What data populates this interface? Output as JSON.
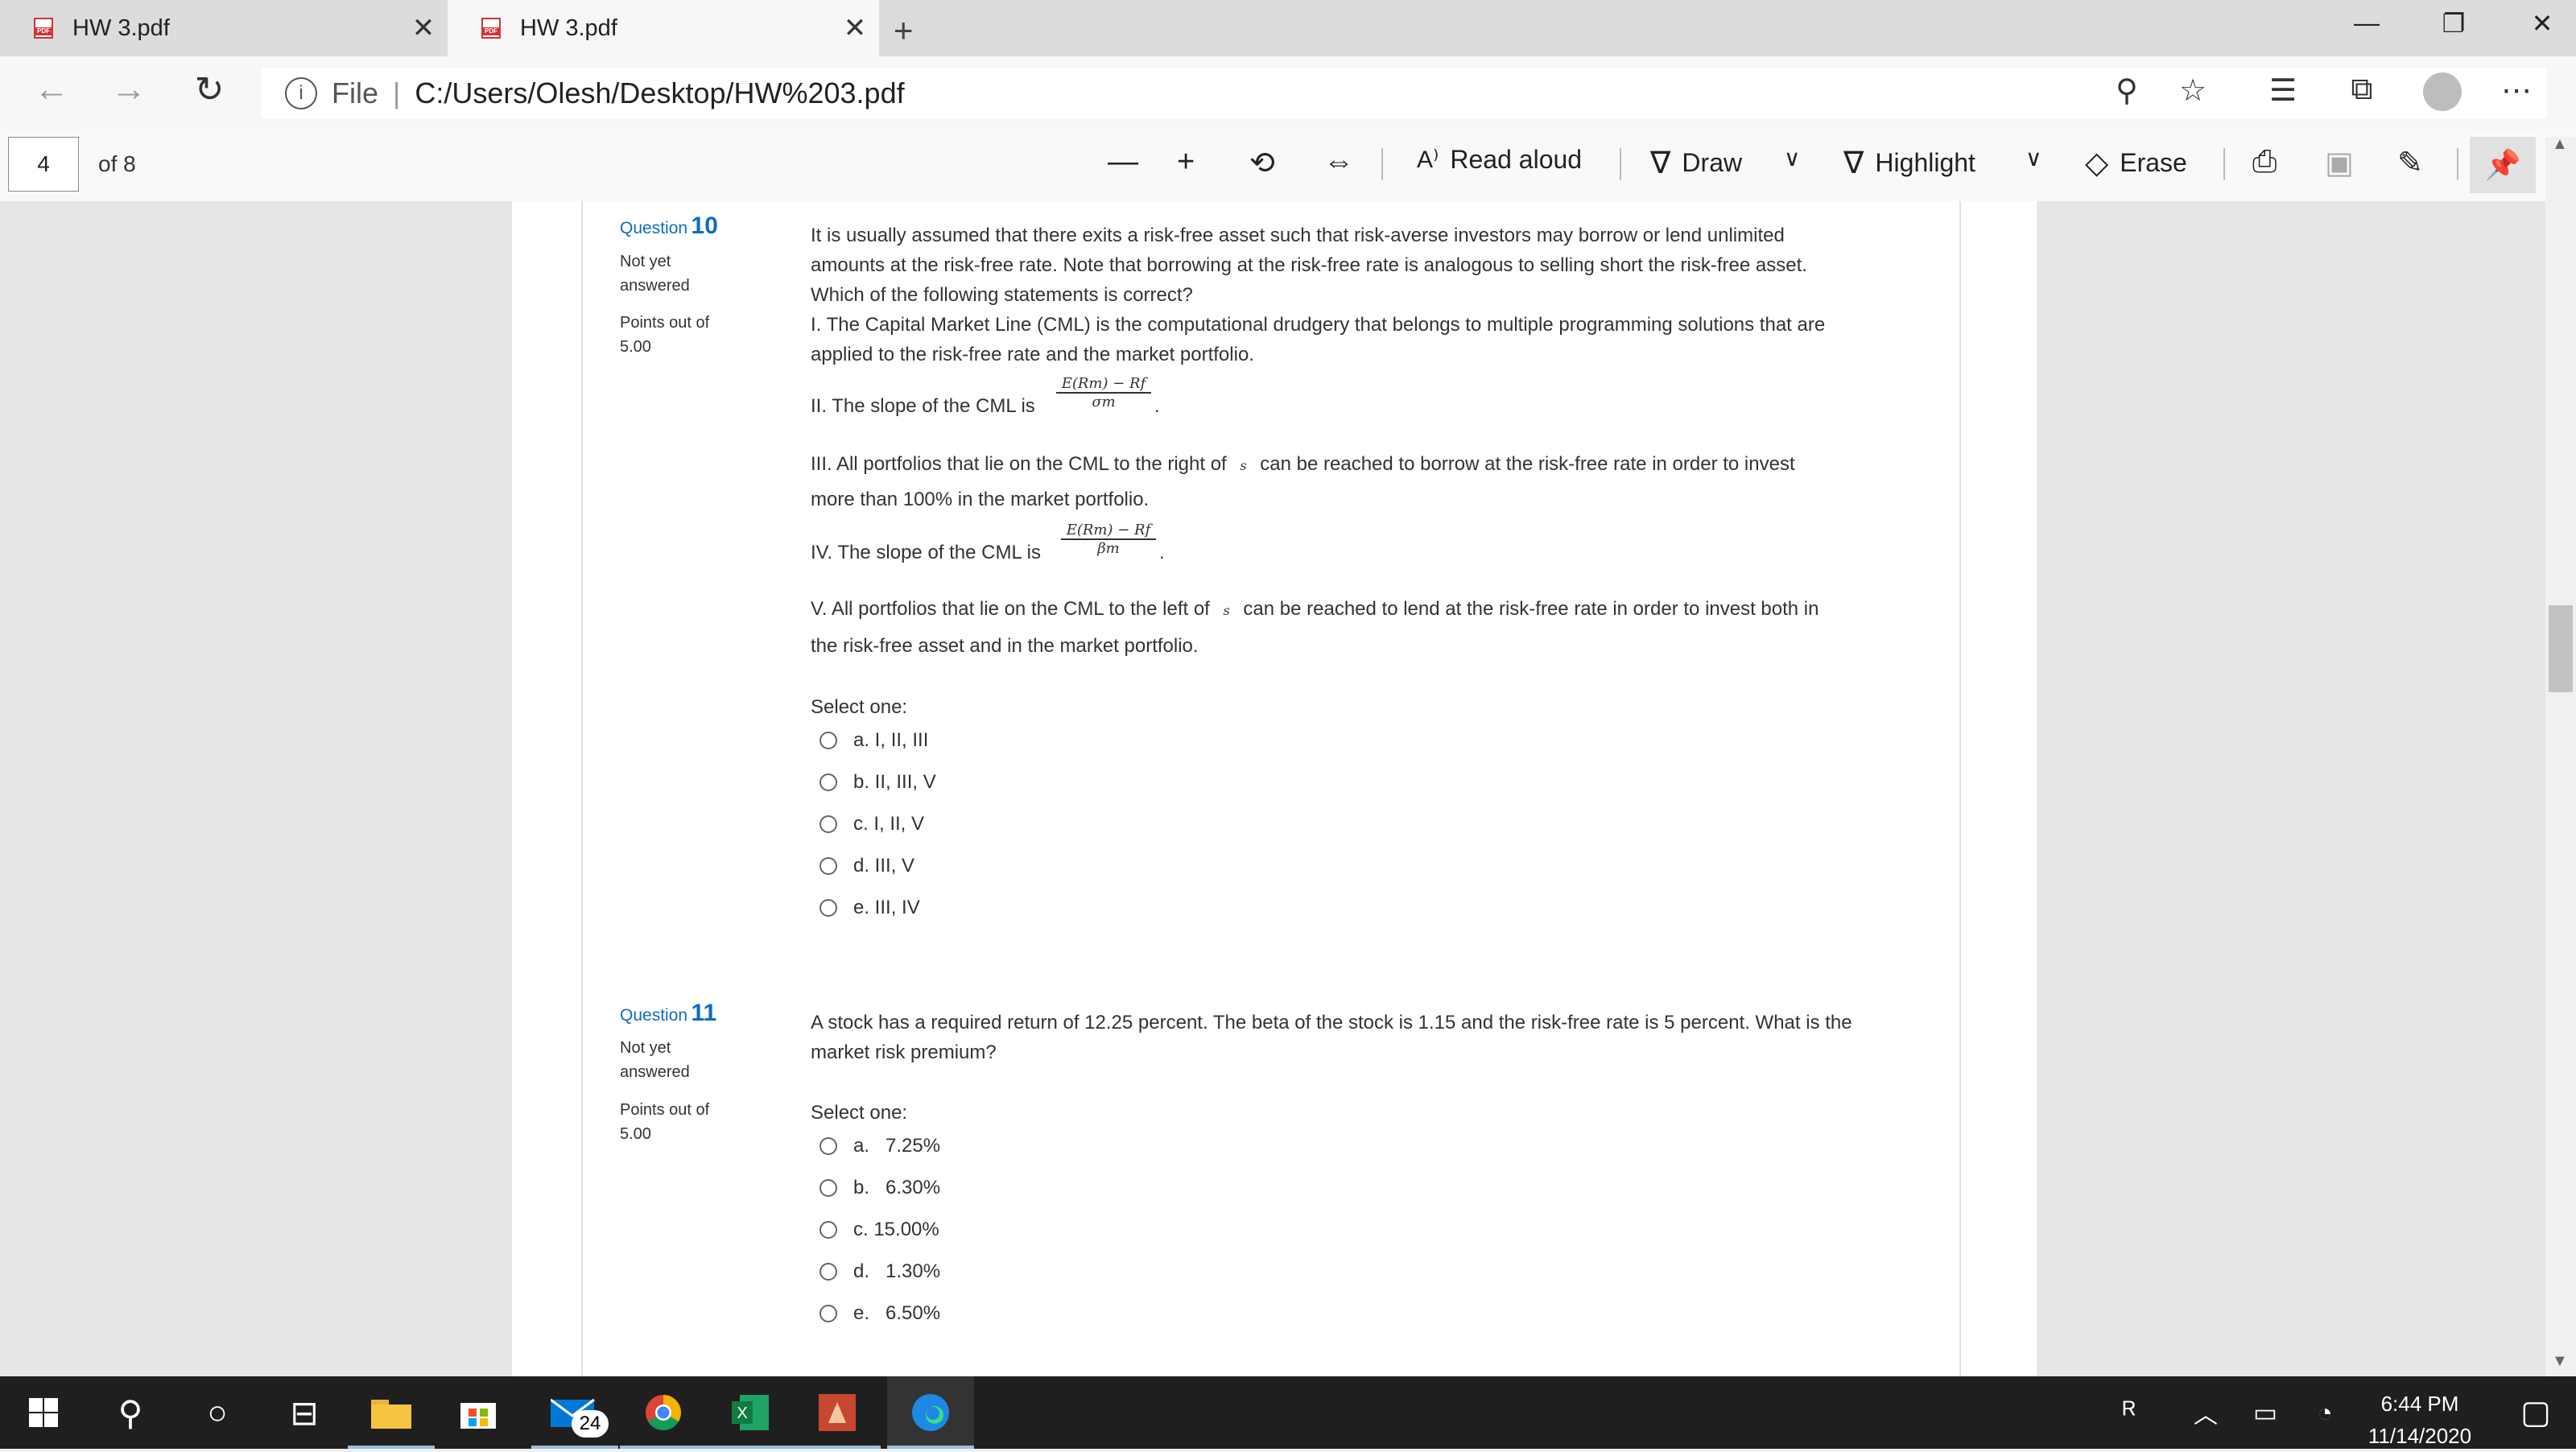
{
  "browser": {
    "tabs": [
      {
        "title": "HW 3.pdf",
        "active": false
      },
      {
        "title": "HW 3.pdf",
        "active": true
      }
    ],
    "new_tab_glyph": "+",
    "tab_close_glyph": "✕",
    "address": {
      "file_label": "File",
      "separator": "|",
      "url": "C:/Users/Olesh/Desktop/HW%203.pdf"
    }
  },
  "pdf_toolbar": {
    "page_current": "4",
    "page_total": "of 8",
    "read_aloud": "Read aloud",
    "draw": "Draw",
    "highlight": "Highlight",
    "erase": "Erase"
  },
  "questions": [
    {
      "label": "Question",
      "number": "10",
      "status_line1": "Not yet",
      "status_line2": "answered",
      "points_line1": "Points out of",
      "points_line2": "5.00",
      "text_lines": [
        "It is usually assumed that there exits a risk-free asset such that risk-averse investors may borrow or lend unlimited",
        "amounts at the risk-free rate.  Note that borrowing at the risk-free rate is analogous to selling short the risk-free asset.",
        "Which of the following statements is correct?",
        "I.  The Capital Market Line (CML) is the computational drudgery that belongs to multiple programming solutions that are",
        "applied to the risk-free rate and the market portfolio."
      ],
      "stmt2": "II.  The slope of the CML is",
      "formula2_num": "E(Rm) − Rf",
      "formula2_den": "σm",
      "stmt3_line1": "III.  All portfolios that lie on the CML to the right of",
      "stmt3_line1b": "can be reached to borrow at the risk-free rate  in order to invest",
      "stmt3_line2": "more than 100% in the market portfolio.",
      "stmt4": "IV.  The slope of the CML is",
      "formula4_num": "E(Rm) − Rf",
      "formula4_den": "βm",
      "stmt5_line1": "V.  All portfolios that lie on the CML to the left of",
      "stmt5_line1b": "can be reached to lend at the risk-free rate in order to invest both in",
      "stmt5_line2": "the risk-free asset and in the market portfolio.",
      "select_label": "Select one:",
      "options": [
        "a. I, II, III",
        "b. II, III, V",
        "c. I, II, V",
        "d. III, V",
        "e. III, IV"
      ]
    },
    {
      "label": "Question",
      "number": "11",
      "status_line1": "Not yet",
      "status_line2": "answered",
      "points_line1": "Points out of",
      "points_line2": "5.00",
      "text_lines": [
        "A stock has a required return of 12.25 percent. The beta of the stock is 1.15 and the risk-free rate is 5 percent. What is the",
        "market risk premium?"
      ],
      "select_label": "Select one:",
      "options": [
        "a.   7.25%",
        "b.   6.30%",
        "c. 15.00%",
        "d.   1.30%",
        "e.   6.50%"
      ]
    }
  ],
  "taskbar": {
    "mail_badge": "24",
    "time": "6:44 PM",
    "date": "11/14/2020"
  },
  "colors": {
    "link_blue": "#0f6cbf",
    "pdf_red": "#d13438",
    "taskbar": "#1f1f1f"
  }
}
